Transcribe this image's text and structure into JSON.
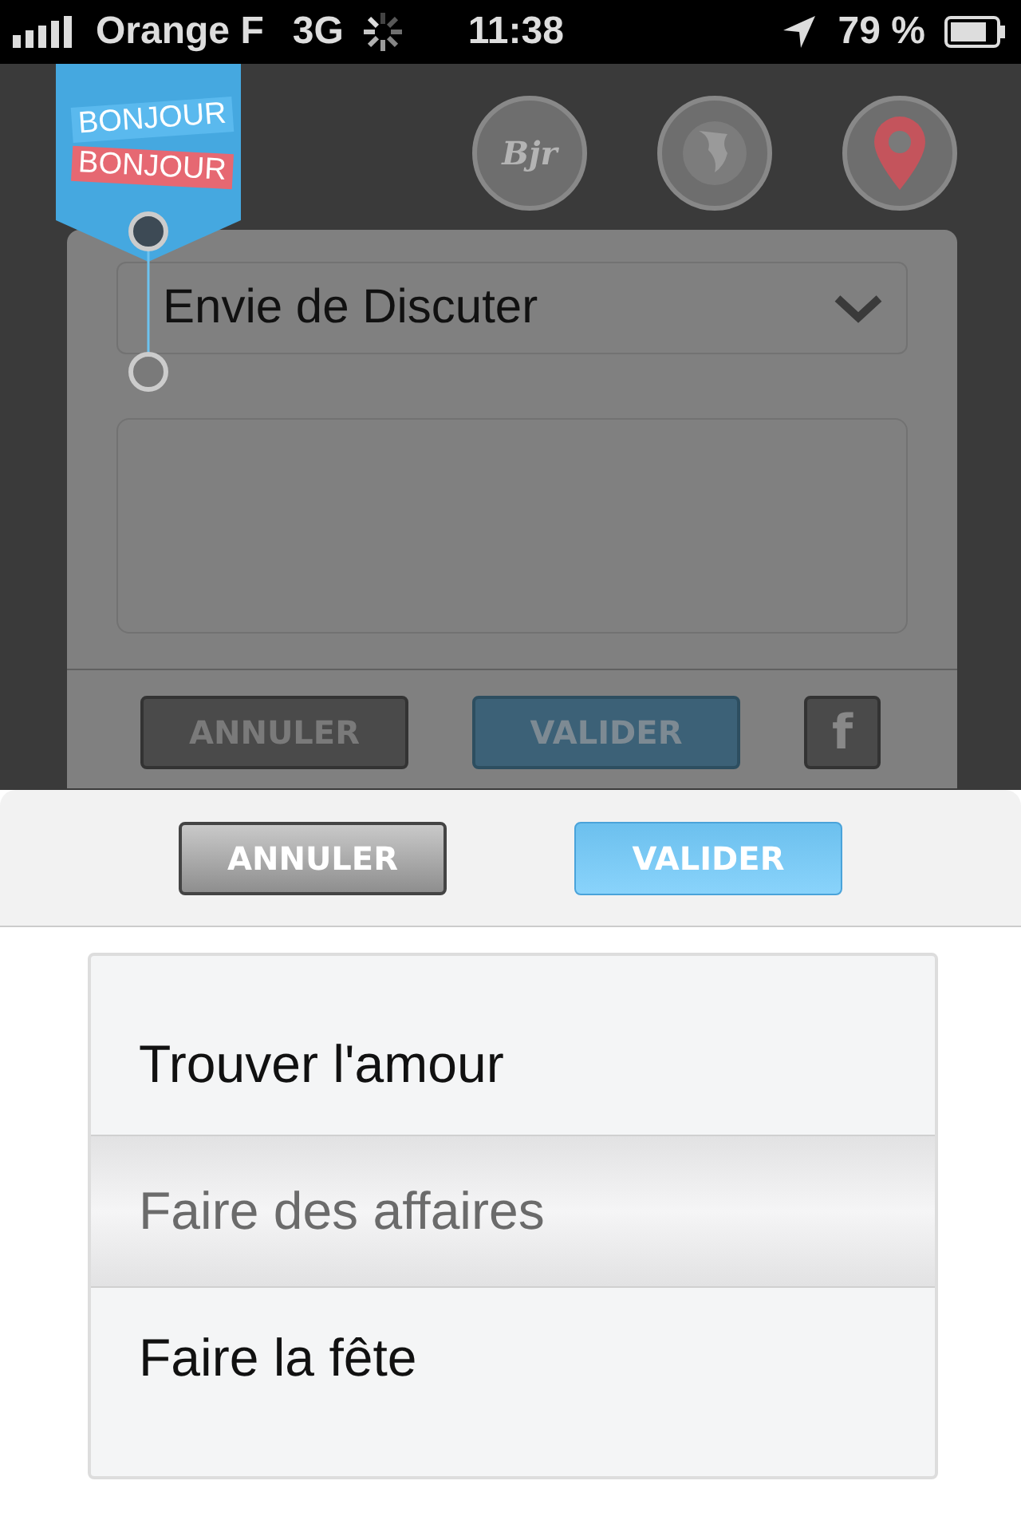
{
  "status_bar": {
    "carrier": "Orange F",
    "network": "3G",
    "time": "11:38",
    "battery": "79 %"
  },
  "logo": {
    "line_1": "BONJOUR",
    "line_2": "BONJOUR"
  },
  "header_buttons": [
    {
      "kind": "bjr",
      "label": "Bjr"
    },
    {
      "kind": "globe"
    },
    {
      "kind": "pin"
    }
  ],
  "form": {
    "dropdown": {
      "value": "Envie de Discuter"
    },
    "buttons": [
      {
        "kind": "cancel",
        "label": "ANNULER"
      },
      {
        "kind": "confirm",
        "label": "VALIDER"
      },
      {
        "kind": "facebook",
        "label": "f"
      }
    ]
  },
  "sheet": {
    "buttons": [
      {
        "kind": "cancel",
        "label": "ANNULER"
      },
      {
        "kind": "confirm",
        "label": "VALIDER"
      }
    ],
    "picker": [
      {
        "label": "Trouver l'amour",
        "selected": false
      },
      {
        "label": "Faire des affaires",
        "selected": true
      },
      {
        "label": "Faire la fête",
        "selected": false
      }
    ]
  }
}
